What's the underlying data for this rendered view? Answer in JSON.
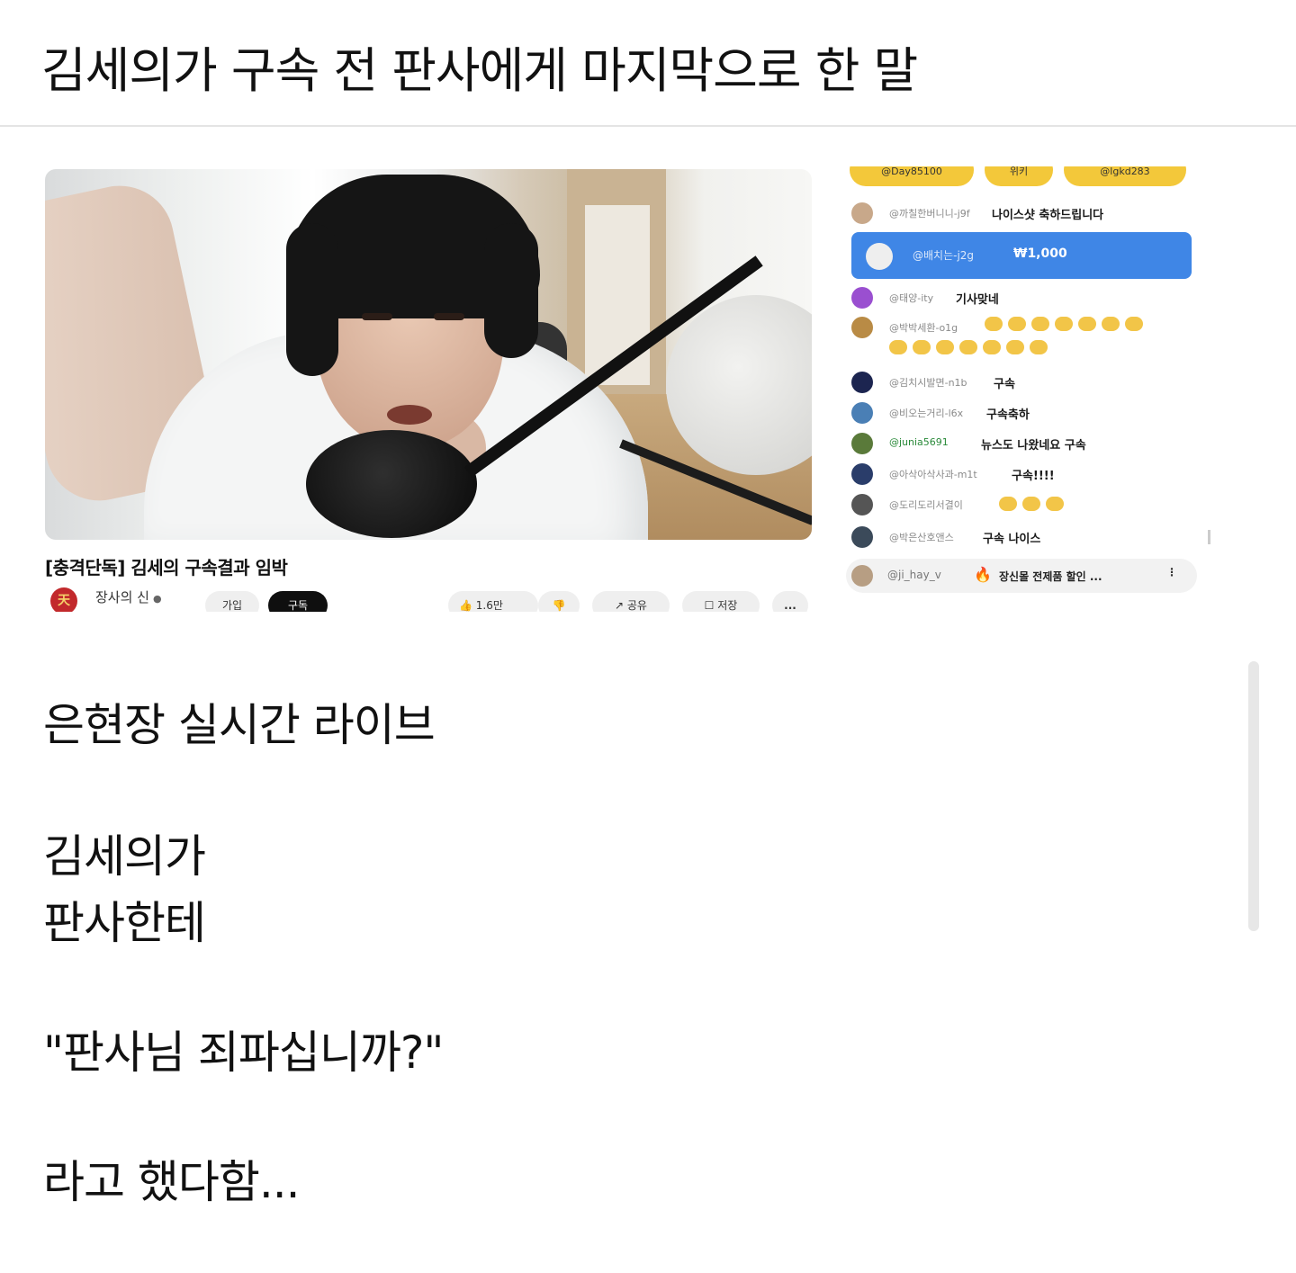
{
  "post": {
    "title": "김세의가 구속 전 판사에게 마지막으로 한 말",
    "paragraphs": [
      "은현장 실시간 라이브",
      "김세의가",
      "판사한테",
      "\"판사님 죄파십니까?\"",
      "라고 했다함..."
    ]
  },
  "video": {
    "title": "[충격단독] 김세의 구속결과 임박",
    "channel": {
      "avatar_text": "天",
      "name": "장사의 신"
    },
    "buttons": {
      "join": "가입",
      "subscribe": "구독",
      "like": "1.6만",
      "share": "공유",
      "save": "저장",
      "more": "..."
    }
  },
  "chat": {
    "top_chips": [
      "@Day85100",
      "위키",
      "@lgkd283"
    ],
    "messages": [
      {
        "user": "@까칠한버니니-j9f",
        "text": "나이스샷 축하드립니다"
      },
      {
        "user": "@배치는-j2g",
        "amount": "₩1,000",
        "superchat": true
      },
      {
        "user": "@태양-ity",
        "text": "기사맞네"
      },
      {
        "user": "@박박세환-o1g",
        "text": ""
      },
      {
        "user": "@김치시발면-n1b",
        "text": "구속"
      },
      {
        "user": "@비오는거리-l6x",
        "text": "구속축하"
      },
      {
        "user": "@junia5691",
        "text": "뉴스도 나왔네요 구속"
      },
      {
        "user": "@아삭아삭사과-m1t",
        "text": "구속!!!!"
      },
      {
        "user": "@도리도리서결이",
        "text": ""
      },
      {
        "user": "@박은산호앤스",
        "text": "구속 나이스"
      }
    ],
    "pinned": {
      "user": "@ji_hay_v",
      "text": "장신몰 전제품 할인 ..."
    }
  },
  "colors": {
    "accent_blue": "#3f86e6",
    "chip_yellow": "#f3c83a"
  }
}
